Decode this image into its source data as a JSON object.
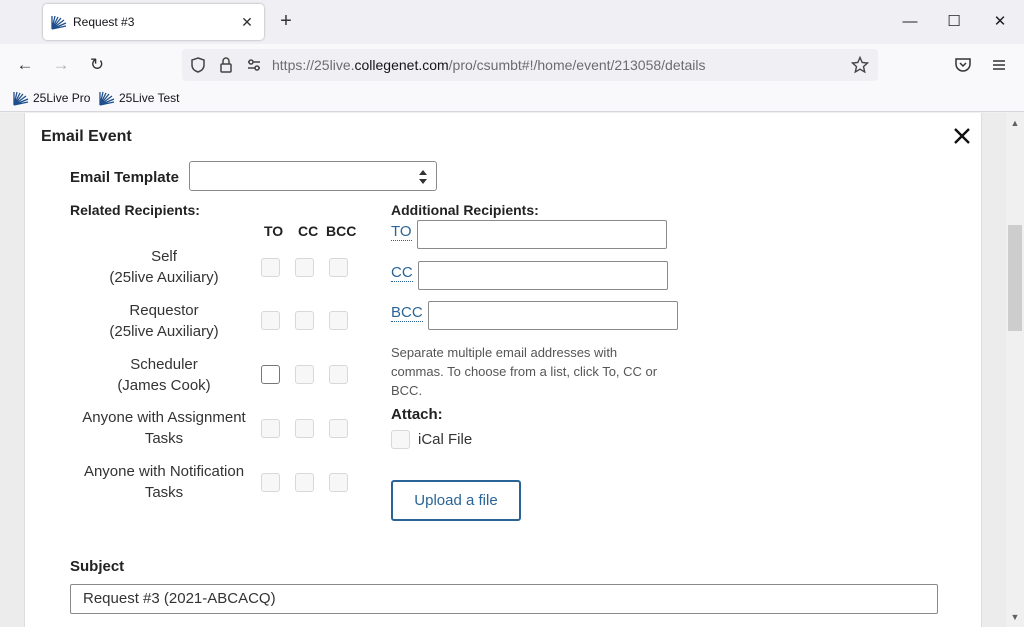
{
  "browser": {
    "tab_title": "Request #3",
    "url_prefix": "https://25live.",
    "url_domain": "collegenet.com",
    "url_path": "/pro/csumbt#!/home/event/213058/details",
    "bookmarks": [
      {
        "label": "25Live Pro"
      },
      {
        "label": "25Live Test"
      }
    ]
  },
  "dialog": {
    "title": "Email Event",
    "template_label": "Email Template",
    "template_value": "",
    "related_label": "Related Recipients:",
    "columns": [
      "TO",
      "CC",
      "BCC"
    ],
    "recipients": [
      {
        "line1": "Self",
        "line2": "(25live Auxiliary)",
        "enabled": [
          false,
          false,
          false
        ]
      },
      {
        "line1": "Requestor",
        "line2": "(25live Auxiliary)",
        "enabled": [
          false,
          false,
          false
        ]
      },
      {
        "line1": "Scheduler",
        "line2": "(James Cook)",
        "enabled": [
          true,
          false,
          false
        ]
      },
      {
        "line1": "Anyone with Assignment",
        "line2": "Tasks",
        "enabled": [
          false,
          false,
          false
        ]
      },
      {
        "line1": "Anyone with Notification",
        "line2": "Tasks",
        "enabled": [
          false,
          false,
          false
        ]
      }
    ],
    "additional_label": "Additional Recipients:",
    "to_link": "TO",
    "cc_link": "CC",
    "bcc_link": "BCC",
    "to_value": "",
    "cc_value": "",
    "bcc_value": "",
    "hint": "Separate multiple email addresses with commas. To choose from a list, click To, CC or BCC.",
    "attach_label": "Attach:",
    "ical_label": "iCal File",
    "upload_label": "Upload a file",
    "subject_label": "Subject",
    "subject_value": "Request #3 (2021-ABCACQ)"
  },
  "colors": {
    "link": "#2a6496",
    "favicon": "#1f4e8c"
  },
  "icons": [
    "shield-icon",
    "lock-icon",
    "permissions-icon",
    "star-icon",
    "pocket-icon",
    "menu-icon",
    "back-icon",
    "forward-icon",
    "reload-icon",
    "close-icon"
  ]
}
